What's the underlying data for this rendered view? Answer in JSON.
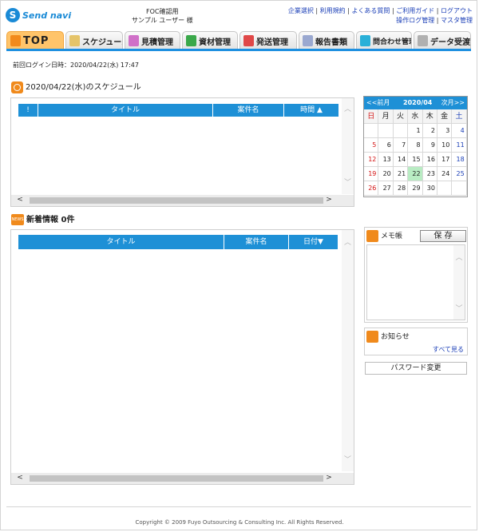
{
  "header": {
    "logo_text": "Send navi",
    "company": "FOC確認用",
    "user": "サンプル ユーザー 様",
    "links_row1": [
      "企業選択",
      "利用規約",
      "よくある質問",
      "ご利用ガイド",
      "ログアウト"
    ],
    "links_row2": [
      "操作ログ管理",
      "マスタ管理"
    ]
  },
  "tabs": [
    {
      "label": "TOP",
      "active": true,
      "icon": "top-icon"
    },
    {
      "label": "スケジュール",
      "icon": "schedule-icon"
    },
    {
      "label": "見積管理",
      "icon": "estimate-icon"
    },
    {
      "label": "資材管理",
      "icon": "materials-icon"
    },
    {
      "label": "発送管理",
      "icon": "shipping-icon"
    },
    {
      "label": "報告書類",
      "icon": "report-icon"
    },
    {
      "label": "問合わせ管理",
      "icon": "inquiry-icon"
    },
    {
      "label": "データ受渡",
      "icon": "data-transfer-icon"
    }
  ],
  "last_login": "前回ログイン日時：2020/04/22(水) 17:47",
  "schedule": {
    "title": "2020/04/22(水)のスケジュール",
    "columns": [
      "!",
      "タイトル",
      "案件名",
      "時間 ▲"
    ],
    "rows": []
  },
  "news": {
    "badge": "NEWS",
    "title": "新着情報 0件",
    "columns": [
      "タイトル",
      "案件名",
      "日付▼"
    ],
    "rows": []
  },
  "calendar": {
    "prev": "<<前月",
    "month": "2020/04",
    "next": "次月>>",
    "dow": [
      "日",
      "月",
      "火",
      "水",
      "木",
      "金",
      "土"
    ],
    "weeks": [
      [
        "",
        "",
        "",
        "1",
        "2",
        "3",
        "4"
      ],
      [
        "5",
        "6",
        "7",
        "8",
        "9",
        "10",
        "11"
      ],
      [
        "12",
        "13",
        "14",
        "15",
        "16",
        "17",
        "18"
      ],
      [
        "19",
        "20",
        "21",
        "22",
        "23",
        "24",
        "25"
      ],
      [
        "26",
        "27",
        "28",
        "29",
        "30",
        "",
        ""
      ]
    ],
    "today": "22"
  },
  "memo": {
    "title": "メモ帳",
    "save": "保 存"
  },
  "notice": {
    "title": "お知らせ",
    "see_all": "すべて見る"
  },
  "password_button": "パスワード変更",
  "footer": "Copyright © 2009 Fuyo Outsourcing & Consulting Inc. All Rights Reserved.",
  "colors": {
    "accent": "#1e90d6",
    "tab_active": "#ffc46a",
    "link": "#1b3fb7"
  }
}
